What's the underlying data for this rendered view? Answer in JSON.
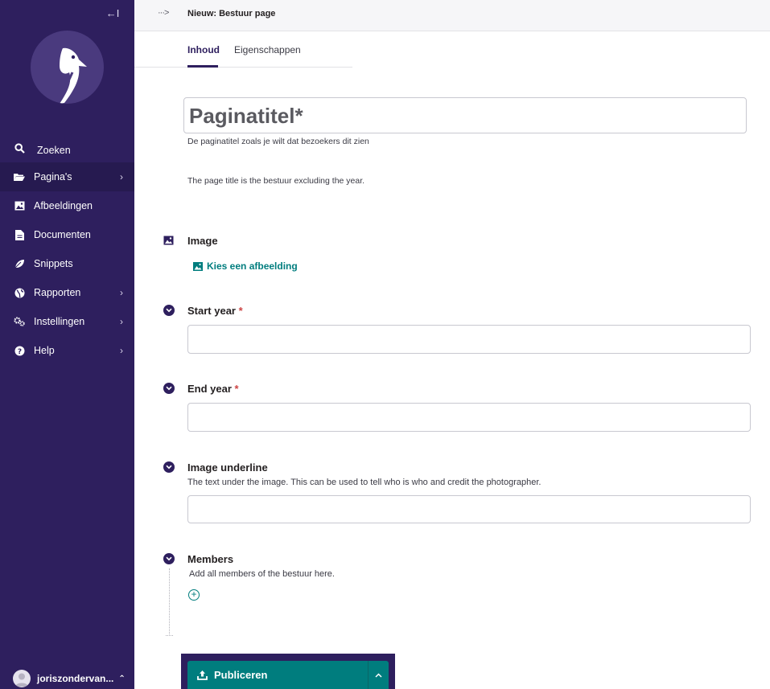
{
  "sidebar": {
    "collapse_label": "←I",
    "items": [
      {
        "label": "Zoeken",
        "icon": "search-icon"
      },
      {
        "label": "Pagina's",
        "icon": "folder-icon",
        "has_children": true
      },
      {
        "label": "Afbeeldingen",
        "icon": "image-icon"
      },
      {
        "label": "Documenten",
        "icon": "document-icon"
      },
      {
        "label": "Snippets",
        "icon": "snippet-icon"
      },
      {
        "label": "Rapporten",
        "icon": "globe-icon",
        "has_children": true
      },
      {
        "label": "Instellingen",
        "icon": "cogs-icon",
        "has_children": true
      },
      {
        "label": "Help",
        "icon": "help-icon",
        "has_children": true
      }
    ],
    "user_name": "joriszondervan...",
    "colors": {
      "background": "#2e1f5e",
      "active": "#261a50"
    }
  },
  "header": {
    "breadcrumb_more": "···>",
    "title": "Nieuw: Bestuur page"
  },
  "tabs": [
    {
      "label": "Inhoud",
      "active": true
    },
    {
      "label": "Eigenschappen",
      "active": false
    }
  ],
  "form": {
    "title_placeholder": "Paginatitel*",
    "title_help": "De paginatitel zoals je wilt dat bezoekers dit zien",
    "title_note": "The page title is the bestuur excluding the year.",
    "image": {
      "label": "Image",
      "choose_label": "Kies een afbeelding"
    },
    "start_year": {
      "label": "Start year",
      "required": "*"
    },
    "end_year": {
      "label": "End year",
      "required": "*"
    },
    "image_underline": {
      "label": "Image underline",
      "help": "The text under the image. This can be used to tell who is who and credit the photographer."
    },
    "members": {
      "label": "Members",
      "help": "Add all members of the bestuur here."
    }
  },
  "footer": {
    "publish_label": "Publiceren",
    "accent": "#007d7e"
  }
}
